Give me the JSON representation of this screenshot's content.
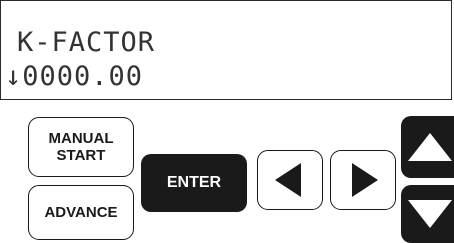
{
  "display": {
    "line1": "K-FACTOR",
    "line2": "↓0000.00"
  },
  "buttons": {
    "manual_start": {
      "line1": "MANUAL",
      "line2": "START"
    },
    "advance": "ADVANCE",
    "enter": "ENTER",
    "left_arrow_icon": "triangle-left",
    "right_arrow_icon": "triangle-right",
    "up_arrow_icon": "triangle-up",
    "down_arrow_icon": "triangle-down"
  },
  "colors": {
    "button_dark": "#1a1a1a",
    "button_light": "#ffffff",
    "lcd_text": "#333333"
  }
}
